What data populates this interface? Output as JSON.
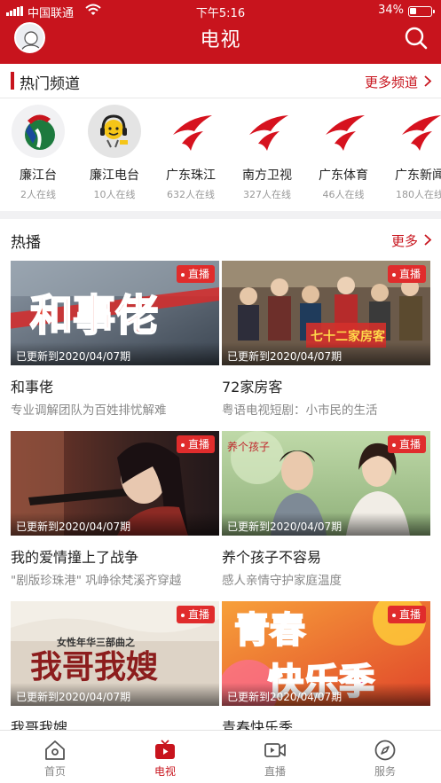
{
  "status_bar": {
    "carrier": "中国联通",
    "time": "下午5:16",
    "battery": "34%",
    "battery_level": 0.34
  },
  "header": {
    "title": "电视"
  },
  "hot_channels": {
    "title": "热门频道",
    "more_label": "更多频道",
    "items": [
      {
        "name": "廉江台",
        "online": "2人在线",
        "logo": "lianjiang-tv-logo"
      },
      {
        "name": "廉江电台",
        "online": "10人在线",
        "logo": "lianjiang-radio-logo"
      },
      {
        "name": "广东珠江",
        "online": "632人在线",
        "logo": "guangdong-tv-logo"
      },
      {
        "name": "南方卫视",
        "online": "327人在线",
        "logo": "guangdong-tv-logo"
      },
      {
        "name": "广东体育",
        "online": "46人在线",
        "logo": "guangdong-tv-logo"
      },
      {
        "name": "广东新闻",
        "online": "180人在线",
        "logo": "guangdong-tv-logo"
      }
    ]
  },
  "hot_shows": {
    "title": "热播",
    "more_label": "更多",
    "live_label": "直播",
    "items": [
      {
        "title": "和事佬",
        "desc": "专业调解团队为百姓排忧解难",
        "updated": "已更新到2020/04/07期",
        "thumb_text": "和事佬"
      },
      {
        "title": "72家房客",
        "desc": "粤语电视短剧：小市民的生活",
        "updated": "已更新到2020/04/07期",
        "thumb_text": "七十二家房客"
      },
      {
        "title": "我的爱情撞上了战争",
        "desc": "\"剧版珍珠港\" 巩峥徐梵溪齐穿越",
        "updated": "已更新到2020/04/07期",
        "thumb_text": ""
      },
      {
        "title": "养个孩子不容易",
        "desc": "感人亲情守护家庭温度",
        "updated": "已更新到2020/04/07期",
        "thumb_text": "养个孩子"
      },
      {
        "title": "我哥我嫂",
        "desc": "",
        "updated": "已更新到2020/04/07期",
        "thumb_text": "女性年华三部曲之",
        "thumb_text2": "我哥我嫂"
      },
      {
        "title": "青春快乐季",
        "desc": "",
        "updated": "已更新到2020/04/07期",
        "thumb_text": "青春",
        "thumb_text2": "快乐季"
      }
    ]
  },
  "tabbar": {
    "items": [
      {
        "label": "首页",
        "icon": "home-icon"
      },
      {
        "label": "电视",
        "icon": "tv-icon"
      },
      {
        "label": "直播",
        "icon": "live-camera-icon"
      },
      {
        "label": "服务",
        "icon": "compass-icon"
      }
    ],
    "active": 1
  },
  "colors": {
    "brand_red": "#c8141d",
    "live_badge": "#e02c2c"
  }
}
